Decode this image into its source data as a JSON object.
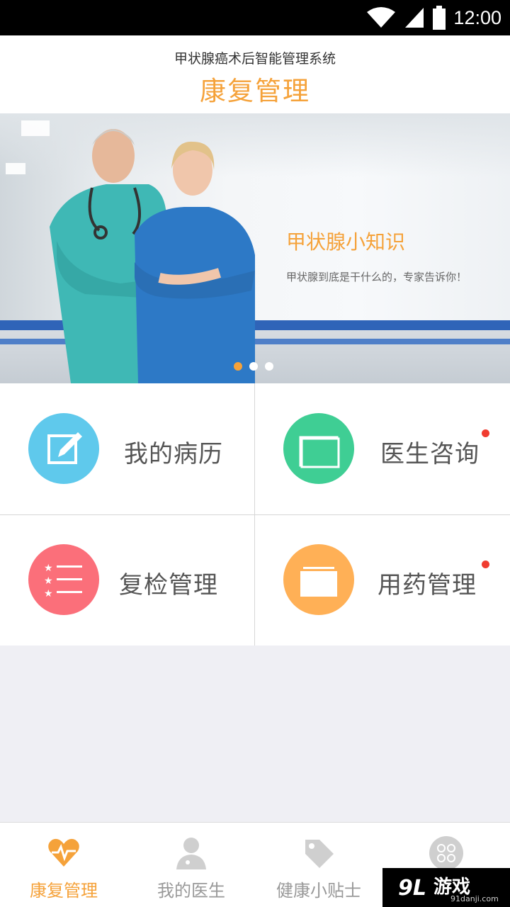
{
  "status_bar": {
    "time": "12:00"
  },
  "header": {
    "subtitle": "甲状腺癌术后智能管理系统",
    "title": "康复管理"
  },
  "banner": {
    "title": "甲状腺小知识",
    "subtitle": "甲状腺到底是干什么的，专家告诉你！",
    "page_count": 3,
    "active_page": 1
  },
  "menu": [
    {
      "label": "我的病历",
      "icon": "edit-icon",
      "color": "#5fc9ec",
      "badge": false
    },
    {
      "label": "医生咨询",
      "icon": "windows-icon",
      "color": "#3fce94",
      "badge": true
    },
    {
      "label": "复检管理",
      "icon": "checklist-icon",
      "color": "#fb6f7a",
      "badge": false
    },
    {
      "label": "用药管理",
      "icon": "folder-icon",
      "color": "#ffb056",
      "badge": true
    }
  ],
  "tabbar": {
    "items": [
      {
        "label": "康复管理",
        "icon": "heartbeat-icon",
        "active": true
      },
      {
        "label": "我的医生",
        "icon": "doctor-icon",
        "active": false
      },
      {
        "label": "健康小贴士",
        "icon": "tag-icon",
        "active": false
      },
      {
        "label": "",
        "icon": "apps-icon",
        "active": false
      }
    ]
  },
  "watermark": {
    "logo": "9L",
    "main": "游戏",
    "sub": "91danji.com"
  },
  "colors": {
    "accent": "#f5a23a",
    "badge": "#f03c30"
  }
}
